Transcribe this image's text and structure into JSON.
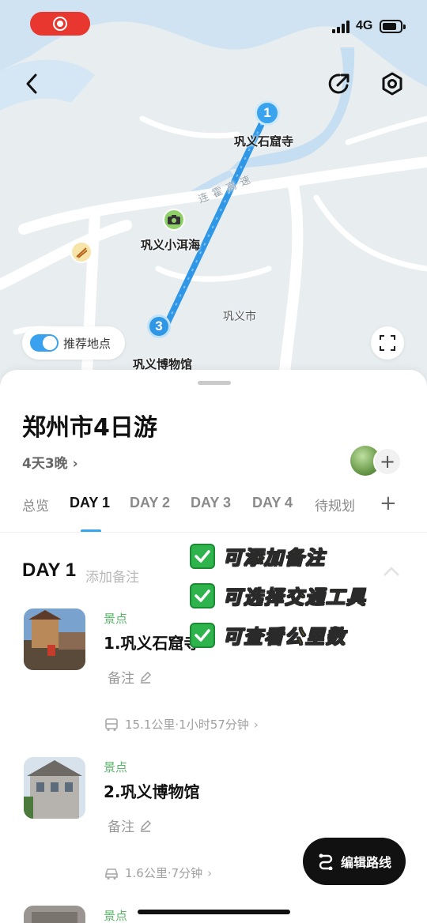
{
  "status_bar": {
    "network": "4G"
  },
  "map": {
    "pins": [
      {
        "number": "1",
        "label": "巩义石窟寺"
      },
      {
        "number": "3",
        "label": "巩义博物馆"
      }
    ],
    "pois": [
      {
        "label": "巩义小洱海",
        "icon": "camera-icon"
      },
      {
        "label": "",
        "icon": "chopsticks-icon"
      }
    ],
    "road_label": "连霍高速",
    "city_label": "巩义市",
    "recommend_toggle": {
      "label": "推荐地点",
      "on": true
    }
  },
  "trip": {
    "title": "郑州市4日游",
    "duration": "4天3晚 ›"
  },
  "tabs": [
    "总览",
    "DAY 1",
    "DAY 2",
    "DAY 3",
    "DAY 4",
    "待规划",
    "+"
  ],
  "active_tab": "DAY 1",
  "day": {
    "title": "DAY 1",
    "note_placeholder": "添加备注"
  },
  "spots": [
    {
      "tag": "景点",
      "name": "1.巩义石窟寺",
      "note_label": "备注",
      "transit": "15.1公里·1小时57分钟",
      "transit_icon": "bus-icon"
    },
    {
      "tag": "景点",
      "name": "2.巩义博物馆",
      "note_label": "备注",
      "transit": "1.6公里·7分钟",
      "transit_icon": "car-icon"
    },
    {
      "tag": "景点"
    }
  ],
  "overlay": [
    "可添加备注",
    "可选择交通工具",
    "可查看公里数"
  ],
  "edit_route": {
    "label": "编辑路线"
  },
  "colors": {
    "accent": "#36a6ee",
    "tag_green": "#5bb46a",
    "recording_red": "#e8372f",
    "overlay_yellow": "#f6d42d"
  }
}
